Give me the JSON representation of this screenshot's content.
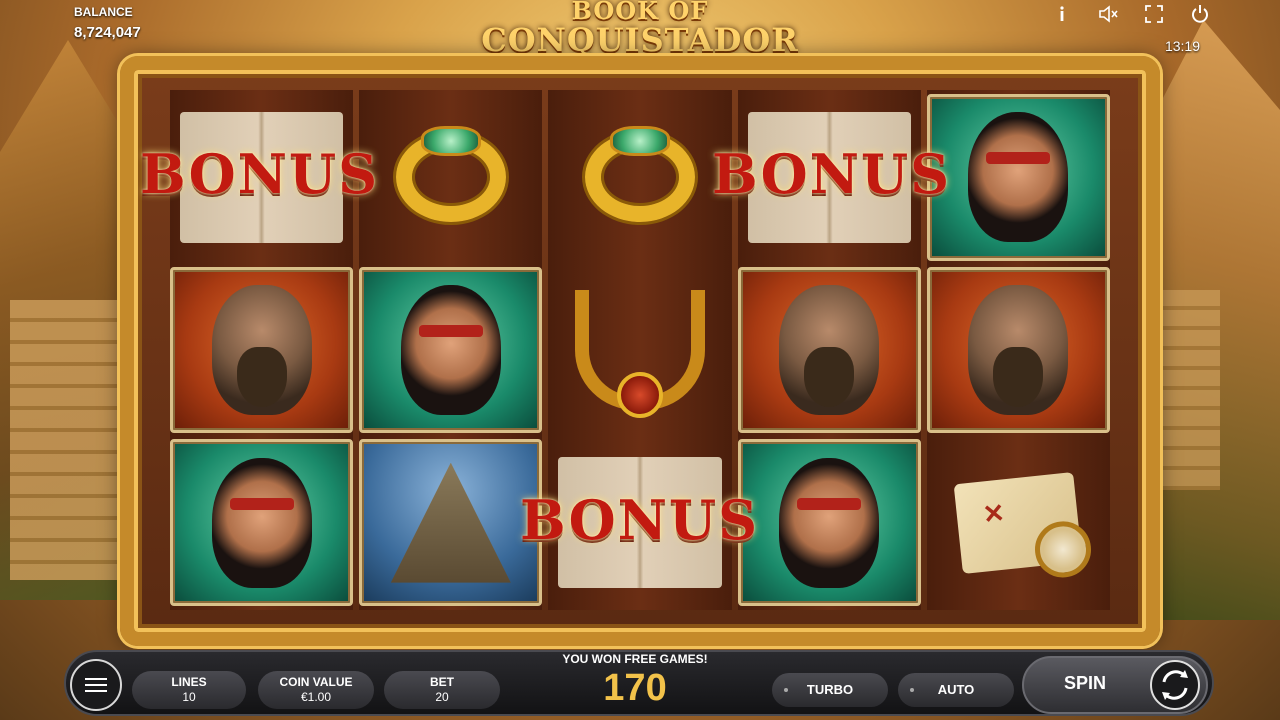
{
  "header": {
    "balance_label": "BALANCE",
    "balance_value": "8,724,047",
    "logo_line1": "BOOK OF",
    "logo_line2": "CONQUISTADOR",
    "clock": "13:19",
    "icons": [
      "info-icon",
      "mute-icon",
      "fullscreen-icon",
      "power-icon"
    ]
  },
  "reels": [
    [
      "bonus-book",
      "conquistador",
      "princess"
    ],
    [
      "jade-ring",
      "princess",
      "pyramid"
    ],
    [
      "jade-ring",
      "necklace",
      "bonus-book"
    ],
    [
      "bonus-book",
      "conquistador",
      "princess"
    ],
    [
      "princess",
      "conquistador",
      "treasure-map"
    ]
  ],
  "bonus_label": "BONUS",
  "controls": {
    "lines_label": "LINES",
    "lines_value": "10",
    "coin_value_label": "COIN VALUE",
    "coin_value": "€1.00",
    "bet_label": "BET",
    "bet_value": "20",
    "win_message": "YOU WON FREE GAMES!",
    "win_amount": "170",
    "turbo_label": "TURBO",
    "auto_label": "AUTO",
    "spin_label": "SPIN"
  },
  "colors": {
    "accent_gold": "#f2c24a",
    "bonus_red": "#c21a10",
    "frame_gold": "#c58a2a"
  }
}
